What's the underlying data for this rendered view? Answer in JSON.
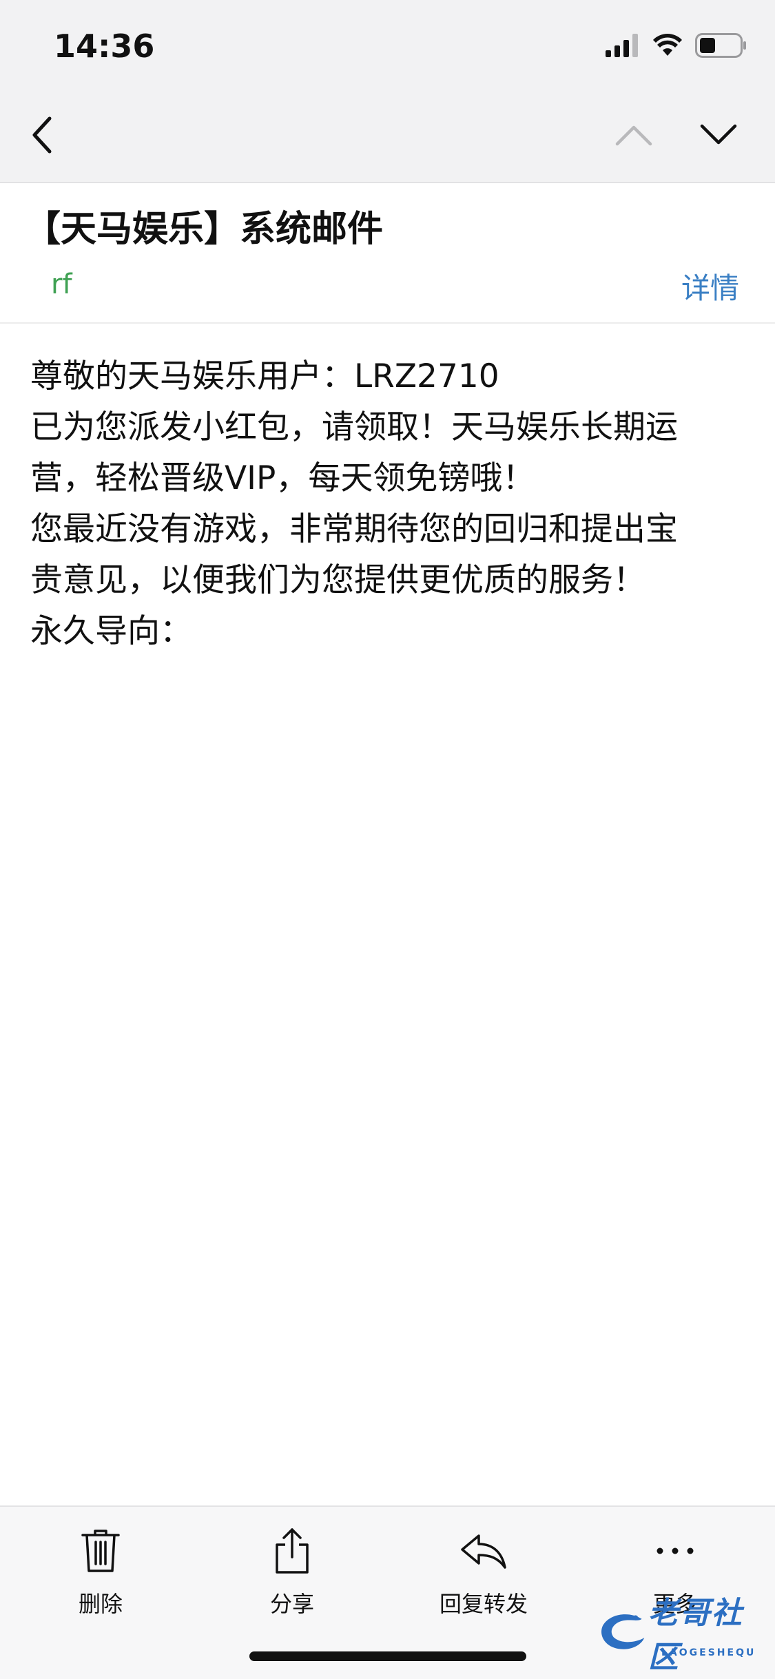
{
  "status_bar": {
    "time": "14:36",
    "icons": [
      "signal-icon",
      "wifi-icon",
      "battery-icon"
    ]
  },
  "nav": {
    "back_icon": "chevron-left-icon",
    "prev_icon": "chevron-up-icon",
    "next_icon": "chevron-down-icon"
  },
  "email": {
    "subject": "【天马娱乐】系统邮件",
    "sender": "rf",
    "details_label": "详情",
    "body_lines": [
      "尊敬的天马娱乐用户：LRZ2710",
      "已为您派发小红包，请领取！天马娱乐长期运",
      "营，轻松晋级VIP，每天领免镑哦！",
      "您最近没有游戏，非常期待您的回归和提出宝",
      "贵意见，以便我们为您提供更优质的服务！",
      "永久导向："
    ]
  },
  "toolbar": {
    "delete_label": "删除",
    "share_label": "分享",
    "reply_label": "回复转发",
    "more_label": "更多"
  },
  "watermark": {
    "text": "老哥社区",
    "sub": "LAOGESHEQU"
  },
  "colors": {
    "sender": "#3fa153",
    "link": "#3a7fc4",
    "background_top": "#f2f2f3",
    "watermark": "#2c6fc2"
  }
}
